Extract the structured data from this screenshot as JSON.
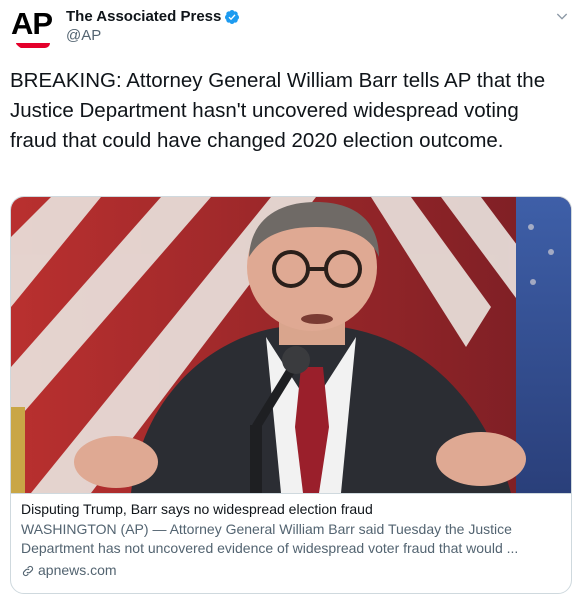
{
  "header": {
    "avatar_logo_text": "AP",
    "display_name": "The Associated Press",
    "handle": "@AP",
    "verified": true
  },
  "tweet": {
    "text": "BREAKING: Attorney General William Barr tells AP that the Justice Department hasn't uncovered widespread voting fraud that could have changed 2020 election outcome."
  },
  "card": {
    "image_subject": "man-speaking-at-microphone-flag-background",
    "title": "Disputing Trump, Barr says no widespread election fraud",
    "description": "WASHINGTON (AP) — Attorney General William Barr said Tuesday the Justice Department has not uncovered evidence of widespread voter fraud that would ...",
    "domain": "apnews.com"
  },
  "colors": {
    "verified_badge": "#1d9bf0",
    "ap_red": "#e4002b",
    "text_primary": "#0f1419",
    "text_secondary": "#536471",
    "border": "#cfd9de"
  }
}
